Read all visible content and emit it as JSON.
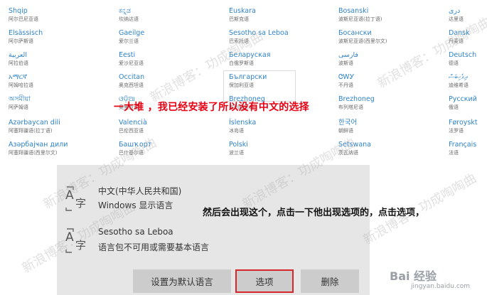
{
  "languages": {
    "col1": [
      {
        "name": "Shqip",
        "sub": "阿尔巴尼亚语"
      },
      {
        "name": "Elsässisch",
        "sub": "阿尔萨斯语"
      },
      {
        "name": "العربية",
        "sub": "阿拉伯语"
      },
      {
        "name": "አማርኛ",
        "sub": "阿姆哈拉语"
      },
      {
        "name": "অসমীয়া",
        "sub": "阿萨姆语"
      },
      {
        "name": "Azərbaycan dili",
        "sub": "阿塞拜疆语(拉丁语)"
      },
      {
        "name": "Азәрбајҹан дили",
        "sub": "阿塞拜疆语(西里尔文)"
      }
    ],
    "col2": [
      {
        "name": "ಕನ್ನಡ",
        "sub": "坎纳达语"
      },
      {
        "name": "Gaeilge",
        "sub": "爱尔兰语"
      },
      {
        "name": "Eesti",
        "sub": "爱沙尼亚语"
      },
      {
        "name": "Occitan",
        "sub": "奥克西坦语"
      },
      {
        "name": "ଓଡ଼ିଆ",
        "sub": "奥里亚语"
      },
      {
        "name": "Valencià",
        "sub": "巴伦西亚语"
      },
      {
        "name": "Башҡорт",
        "sub": "巴什基尔语"
      }
    ],
    "col3": [
      {
        "name": "Euskara",
        "sub": "巴斯克语"
      },
      {
        "name": "Sesotho sa Leboa",
        "sub": "巴索托语"
      },
      {
        "name": "Беларуская",
        "sub": "白俄罗斯语"
      },
      {
        "name": "Български",
        "sub": "保加利亚语"
      },
      {
        "name": "Brezhoneg",
        "sub": "布列塔尼语"
      },
      {
        "name": "Íslenska",
        "sub": "冰岛语"
      },
      {
        "name": "Polski",
        "sub": "波兰语"
      }
    ],
    "col4": [
      {
        "name": "Bosanski",
        "sub": "波斯尼亚语(拉丁语)"
      },
      {
        "name": "Босански",
        "sub": "波斯尼亚语(西里尔文)"
      },
      {
        "name": "فارسی",
        "sub": "波斯语"
      },
      {
        "name": "ᏣᎳᎩ",
        "sub": "不丹语"
      },
      {
        "name": "Brezhoneg",
        "sub": "布列塔尼语"
      },
      {
        "name": "한국어",
        "sub": "朝鲜语"
      },
      {
        "name": "Setswana",
        "sub": "茨瓦纳语"
      }
    ],
    "col5": [
      {
        "name": "دری",
        "sub": "达里语"
      },
      {
        "name": "Dansk",
        "sub": "丹麦语"
      },
      {
        "name": "Deutsch",
        "sub": "德语"
      },
      {
        "name": "ދިވެހިބަސް",
        "sub": "迪维希语"
      },
      {
        "name": "Русский",
        "sub": "俄语"
      },
      {
        "name": "Føroyskt",
        "sub": "法罗语"
      },
      {
        "name": "Français",
        "sub": "法语"
      }
    ]
  },
  "annotations": {
    "top": "一大堆 ，我已经安装了所以没有中文的选择",
    "middle": "然后会出现这个，点击一下他出现选项的，点击选项，"
  },
  "panel": {
    "rows": [
      {
        "icon": "language-icon",
        "title": "中文(中华人民共和国)",
        "sub": "Windows 显示语言"
      },
      {
        "icon": "language-icon",
        "title": "Sesotho sa Leboa",
        "sub": "语言包不可用或需要基本语言"
      }
    ],
    "buttons": {
      "set_default": "设置为默认语言",
      "options": "选项",
      "delete": "删除"
    }
  },
  "watermark": {
    "text": "新浪博客：功成啕啕曲",
    "baidu": "Bai 经验",
    "baidu_url": "jingyan.baidu.com"
  },
  "colors": {
    "accent": "#2f83c9",
    "annotation_red": "#e60012",
    "highlight_border": "#d7262b"
  }
}
